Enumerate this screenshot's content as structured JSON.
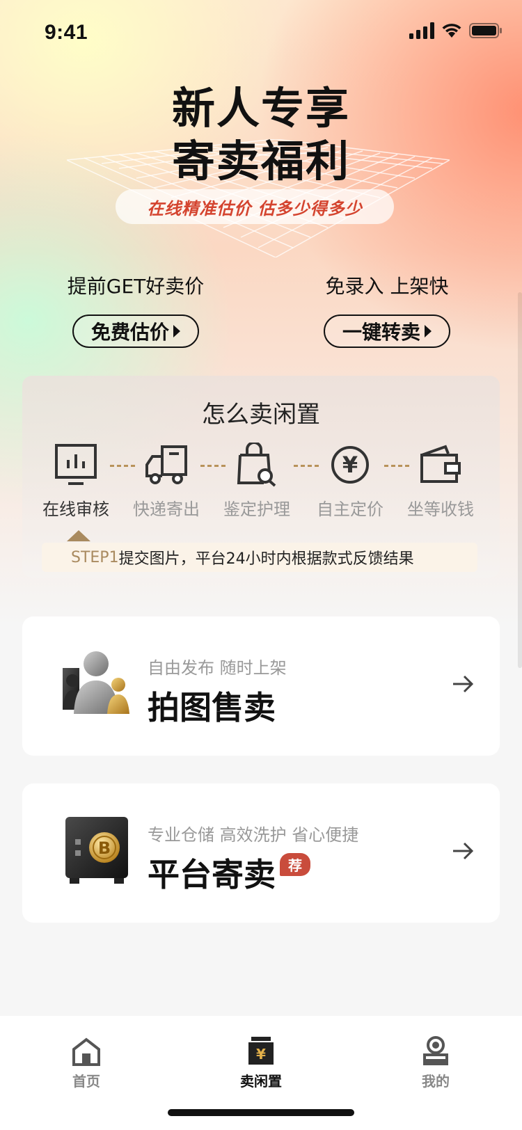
{
  "status_bar": {
    "time": "9:41"
  },
  "hero": {
    "title_line1": "新人专享",
    "title_line2": "寄卖福利",
    "pill_text": "在线精准估价 估多少得多少"
  },
  "promos": [
    {
      "subtitle": "提前GET好卖价",
      "button": "免费估价"
    },
    {
      "subtitle": "免录入 上架快",
      "button": "一键转卖"
    }
  ],
  "how_to_sell": {
    "title": "怎么卖闲置",
    "steps": [
      {
        "label": "在线审核",
        "icon": "monitor-chart-icon",
        "active": true
      },
      {
        "label": "快递寄出",
        "icon": "truck-icon",
        "active": false
      },
      {
        "label": "鉴定护理",
        "icon": "bag-search-icon",
        "active": false
      },
      {
        "label": "自主定价",
        "icon": "yen-circle-icon",
        "active": false
      },
      {
        "label": "坐等收钱",
        "icon": "wallet-icon",
        "active": false
      }
    ],
    "step_no": "STEP1",
    "step_text": "提交图片，平台24小时内根据款式反馈结果"
  },
  "options": [
    {
      "subtitle": "自由发布 随时上架",
      "title": "拍图售卖",
      "icon": "users-figure-icon"
    },
    {
      "subtitle": "专业仓储 高效洗护 省心便捷",
      "title": "平台寄卖",
      "badge": "荐",
      "icon": "safe-bitcoin-icon"
    }
  ],
  "tabbar": {
    "items": [
      {
        "label": "首页",
        "icon": "home-icon",
        "active": false
      },
      {
        "label": "卖闲置",
        "icon": "shop-yen-icon",
        "active": true
      },
      {
        "label": "我的",
        "icon": "profile-icon",
        "active": false
      }
    ]
  },
  "colors": {
    "accent_gold": "#a98a5f",
    "brand_red": "#d4442f",
    "badge_red": "#c94c3c"
  }
}
